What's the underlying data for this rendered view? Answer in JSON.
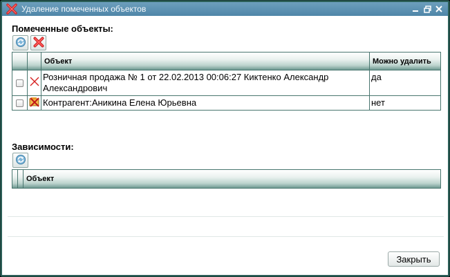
{
  "window": {
    "title": "Удаление помеченных объектов",
    "icon": "delete-marked-icon"
  },
  "marked": {
    "section_label": "Помеченные объекты:",
    "columns": {
      "object": "Объект",
      "can_delete": "Можно удалить"
    },
    "rows": [
      {
        "object": "Розничная продажа № 1 от 22.02.2013 00:06:27 Киктенко Александр Александрович",
        "can_delete": "да",
        "icon": "document-marked-icon",
        "checked": false
      },
      {
        "object": "Контрагент:Аникина Елена Юрьевна",
        "can_delete": "нет",
        "icon": "catalog-marked-icon",
        "checked": false
      }
    ]
  },
  "dependencies": {
    "section_label": "Зависимости:",
    "columns": {
      "object": "Объект"
    },
    "rows": []
  },
  "footer": {
    "close_label": "Закрыть"
  },
  "colors": {
    "titlebar": "#5a90b0",
    "frame": "#2b5f58",
    "grid_border": "#48756e",
    "delete_red": "#d62020"
  }
}
